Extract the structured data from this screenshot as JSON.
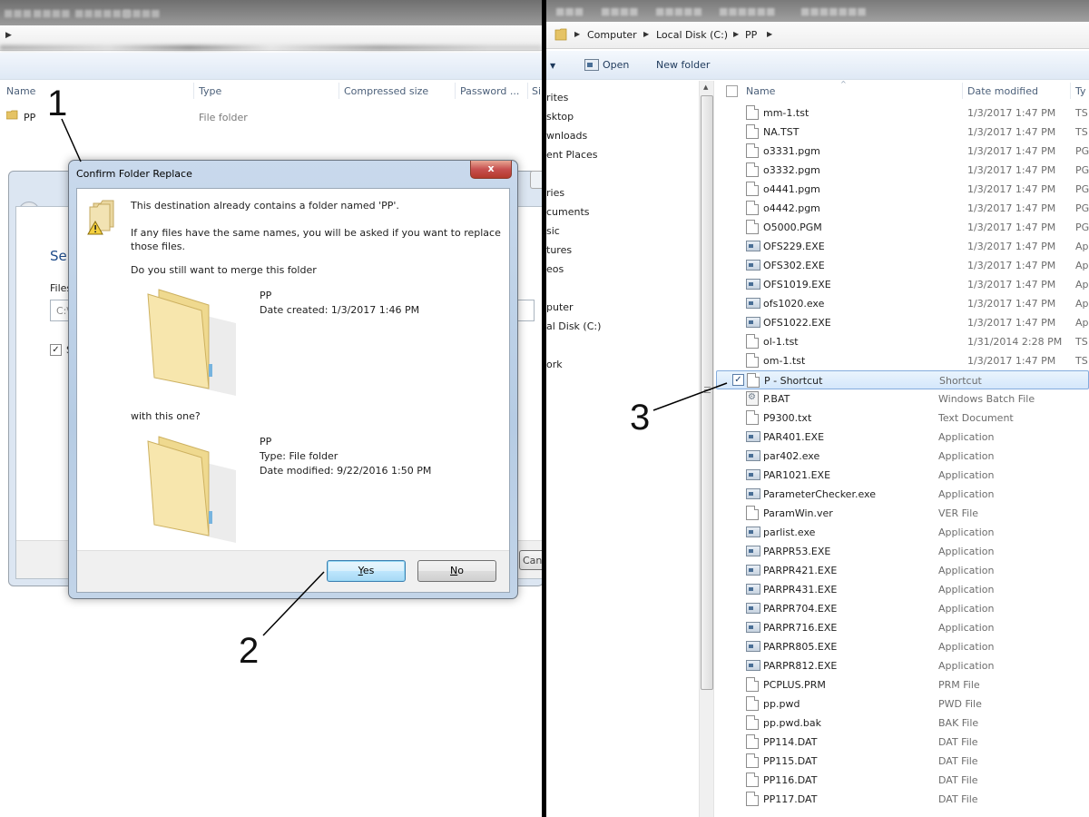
{
  "left": {
    "columns": [
      "Name",
      "Type",
      "Compressed size",
      "Password ...",
      "Si"
    ],
    "row": {
      "name": "PP",
      "type": "File folder"
    },
    "bg_dialog": {
      "heading": "Sel",
      "file_label": "Files",
      "input_value": "C:\\",
      "checkbox_label": "Sh",
      "cancel_label": "Cance"
    },
    "confirm": {
      "title": "Confirm Folder Replace",
      "close": "x",
      "msg1": "This destination already contains a folder named 'PP'.",
      "msg2a": "If any files have the same names, you will be asked if you want to replace",
      "msg2b": "those files.",
      "msg3": "Do you still want to merge this folder",
      "src_name": "PP",
      "src_date": "Date created: 1/3/2017 1:46 PM",
      "with": "with this one?",
      "dst_name": "PP",
      "dst_type": "Type: File folder",
      "dst_date": "Date modified: 9/22/2016 1:50 PM",
      "yes_u": "Y",
      "yes_rest": "es",
      "no_u": "N",
      "no_rest": "o"
    }
  },
  "annotations": [
    "1",
    "2",
    "3"
  ],
  "right": {
    "breadcrumb": [
      "Computer",
      "Local Disk (C:)",
      "PP"
    ],
    "toolbar": {
      "open": "Open",
      "new_folder": "New folder"
    },
    "nav": [
      "rites",
      "sktop",
      "wnloads",
      "ent Places",
      "ries",
      "cuments",
      "sic",
      "tures",
      "eos",
      "puter",
      "al Disk (C:)",
      "ork"
    ],
    "columns": {
      "name": "Name",
      "date": "Date modified",
      "type": "Ty"
    },
    "files": [
      {
        "name": "mm-1.tst",
        "date": "1/3/2017 1:47 PM",
        "type": "TS",
        "icon": "doc"
      },
      {
        "name": "NA.TST",
        "date": "1/3/2017 1:47 PM",
        "type": "TS",
        "icon": "doc"
      },
      {
        "name": "o3331.pgm",
        "date": "1/3/2017 1:47 PM",
        "type": "PG",
        "icon": "doc"
      },
      {
        "name": "o3332.pgm",
        "date": "1/3/2017 1:47 PM",
        "type": "PG",
        "icon": "doc"
      },
      {
        "name": "o4441.pgm",
        "date": "1/3/2017 1:47 PM",
        "type": "PG",
        "icon": "doc"
      },
      {
        "name": "o4442.pgm",
        "date": "1/3/2017 1:47 PM",
        "type": "PG",
        "icon": "doc"
      },
      {
        "name": "O5000.PGM",
        "date": "1/3/2017 1:47 PM",
        "type": "PG",
        "icon": "doc"
      },
      {
        "name": "OFS229.EXE",
        "date": "1/3/2017 1:47 PM",
        "type": "Ap",
        "icon": "exe"
      },
      {
        "name": "OFS302.EXE",
        "date": "1/3/2017 1:47 PM",
        "type": "Ap",
        "icon": "exe"
      },
      {
        "name": "OFS1019.EXE",
        "date": "1/3/2017 1:47 PM",
        "type": "Ap",
        "icon": "exe"
      },
      {
        "name": "ofs1020.exe",
        "date": "1/3/2017 1:47 PM",
        "type": "Ap",
        "icon": "exe"
      },
      {
        "name": "OFS1022.EXE",
        "date": "1/3/2017 1:47 PM",
        "type": "Ap",
        "icon": "exe"
      },
      {
        "name": "ol-1.tst",
        "date": "1/31/2014 2:28 PM",
        "type": "TS",
        "icon": "doc"
      },
      {
        "name": "om-1.tst",
        "date": "1/3/2017 1:47 PM",
        "type": "TS",
        "icon": "doc"
      }
    ],
    "files2": [
      {
        "name": "P - Shortcut",
        "type": "Shortcut",
        "icon": "doc",
        "selected": true
      },
      {
        "name": "P.BAT",
        "type": "Windows Batch File",
        "icon": "bat"
      },
      {
        "name": "P9300.txt",
        "type": "Text Document",
        "icon": "doc"
      },
      {
        "name": "PAR401.EXE",
        "type": "Application",
        "icon": "exe"
      },
      {
        "name": "par402.exe",
        "type": "Application",
        "icon": "exe"
      },
      {
        "name": "PAR1021.EXE",
        "type": "Application",
        "icon": "exe"
      },
      {
        "name": "ParameterChecker.exe",
        "type": "Application",
        "icon": "exe"
      },
      {
        "name": "ParamWin.ver",
        "type": "VER File",
        "icon": "doc"
      },
      {
        "name": "parlist.exe",
        "type": "Application",
        "icon": "exe"
      },
      {
        "name": "PARPR53.EXE",
        "type": "Application",
        "icon": "exe"
      },
      {
        "name": "PARPR421.EXE",
        "type": "Application",
        "icon": "exe"
      },
      {
        "name": "PARPR431.EXE",
        "type": "Application",
        "icon": "exe"
      },
      {
        "name": "PARPR704.EXE",
        "type": "Application",
        "icon": "exe"
      },
      {
        "name": "PARPR716.EXE",
        "type": "Application",
        "icon": "exe"
      },
      {
        "name": "PARPR805.EXE",
        "type": "Application",
        "icon": "exe"
      },
      {
        "name": "PARPR812.EXE",
        "type": "Application",
        "icon": "exe"
      },
      {
        "name": "PCPLUS.PRM",
        "type": "PRM File",
        "icon": "doc"
      },
      {
        "name": "pp.pwd",
        "type": "PWD File",
        "icon": "doc"
      },
      {
        "name": "pp.pwd.bak",
        "type": "BAK File",
        "icon": "doc"
      },
      {
        "name": "PP114.DAT",
        "type": "DAT File",
        "icon": "doc"
      },
      {
        "name": "PP115.DAT",
        "type": "DAT File",
        "icon": "doc"
      },
      {
        "name": "PP116.DAT",
        "type": "DAT File",
        "icon": "doc"
      },
      {
        "name": "PP117.DAT",
        "type": "DAT File",
        "icon": "doc"
      }
    ]
  }
}
